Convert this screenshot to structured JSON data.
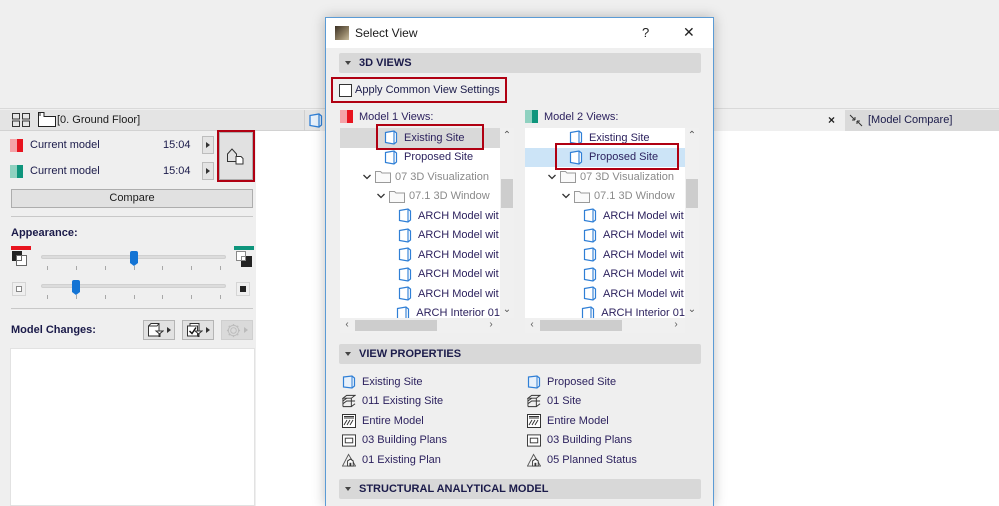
{
  "palette": {
    "tabbar": {
      "view_label": "[0. Ground Floor]"
    },
    "models": [
      {
        "label": "Current model",
        "time": "15:04",
        "colors": [
          "#f5a3a8",
          "#e8141f"
        ]
      },
      {
        "label": "Current model",
        "time": "15:04",
        "colors": [
          "#8fd1c0",
          "#0e957c"
        ]
      }
    ],
    "compare_label": "Compare",
    "appearance": {
      "label": "Appearance:",
      "model1_color": "#e8141f",
      "model2_color": "#0e957c",
      "slider1_value_percent": 50,
      "slider2_value_percent": 16.7,
      "tick_count": 7
    },
    "model_changes_label": "Model Changes:"
  },
  "canvas": {
    "compare_tab_label": "[Model Compare]",
    "close_glyph": "×"
  },
  "dialog": {
    "title": "Select View",
    "help_glyph": "?",
    "close_glyph": "✕",
    "sections": {
      "views_3d": "3D VIEWS",
      "view_properties": "VIEW PROPERTIES",
      "structural": "STRUCTURAL ANALYTICAL MODEL"
    },
    "apply_common_label": "Apply Common View Settings",
    "apply_common_checked": false,
    "model1": {
      "label": "Model 1 Views:",
      "colors": [
        "#f5a3a8",
        "#e8141f"
      ],
      "tree": [
        {
          "text": "Existing Site",
          "type": "view",
          "level": 2,
          "selected": true
        },
        {
          "text": "Proposed Site",
          "type": "view",
          "level": 2
        },
        {
          "text": "07 3D Visualization",
          "type": "folder",
          "level": 1,
          "expanded": true
        },
        {
          "text": "07.1 3D Window",
          "type": "folder",
          "level": 2,
          "expanded": true
        },
        {
          "text": "ARCH Model wit",
          "type": "view",
          "level": 3
        },
        {
          "text": "ARCH Model wit",
          "type": "view",
          "level": 3
        },
        {
          "text": "ARCH Model wit",
          "type": "view",
          "level": 3
        },
        {
          "text": "ARCH Model wit",
          "type": "view",
          "level": 3
        },
        {
          "text": "ARCH Model wit",
          "type": "view",
          "level": 3
        },
        {
          "text": "ARCH Interior 01",
          "type": "view",
          "level": 3
        }
      ]
    },
    "model2": {
      "label": "Model 2 Views:",
      "colors": [
        "#8fd1c0",
        "#0e957c"
      ],
      "tree": [
        {
          "text": "Existing Site",
          "type": "view",
          "level": 2
        },
        {
          "text": "Proposed Site",
          "type": "view",
          "level": 2,
          "selected": true
        },
        {
          "text": "07 3D Visualization",
          "type": "folder",
          "level": 1,
          "expanded": true
        },
        {
          "text": "07.1 3D Window",
          "type": "folder",
          "level": 2,
          "expanded": true
        },
        {
          "text": "ARCH Model wit",
          "type": "view",
          "level": 3
        },
        {
          "text": "ARCH Model wit",
          "type": "view",
          "level": 3
        },
        {
          "text": "ARCH Model wit",
          "type": "view",
          "level": 3
        },
        {
          "text": "ARCH Model wit",
          "type": "view",
          "level": 3
        },
        {
          "text": "ARCH Model wit",
          "type": "view",
          "level": 3
        },
        {
          "text": "ARCH Interior 01",
          "type": "view",
          "level": 3
        }
      ]
    },
    "properties": {
      "model1": [
        {
          "icon": "3d-view-icon",
          "text": "Existing Site"
        },
        {
          "icon": "layers-icon",
          "text": "011 Existing Site"
        },
        {
          "icon": "model-filter-icon",
          "text": "Entire Model"
        },
        {
          "icon": "pen-set-icon",
          "text": "03 Building Plans"
        },
        {
          "icon": "renovation-icon",
          "text": "01 Existing Plan"
        }
      ],
      "model2": [
        {
          "icon": "3d-view-icon",
          "text": "Proposed Site"
        },
        {
          "icon": "layers-icon",
          "text": "01 Site"
        },
        {
          "icon": "model-filter-icon",
          "text": "Entire Model"
        },
        {
          "icon": "pen-set-icon",
          "text": "03 Building Plans"
        },
        {
          "icon": "renovation-icon",
          "text": "05 Planned Status"
        }
      ]
    }
  },
  "colors": {
    "highlight_red": "#b00012",
    "accent_blue": "#1474d4",
    "dialog_border": "#5b9bd5",
    "selection_blue": "#cce4f7"
  }
}
